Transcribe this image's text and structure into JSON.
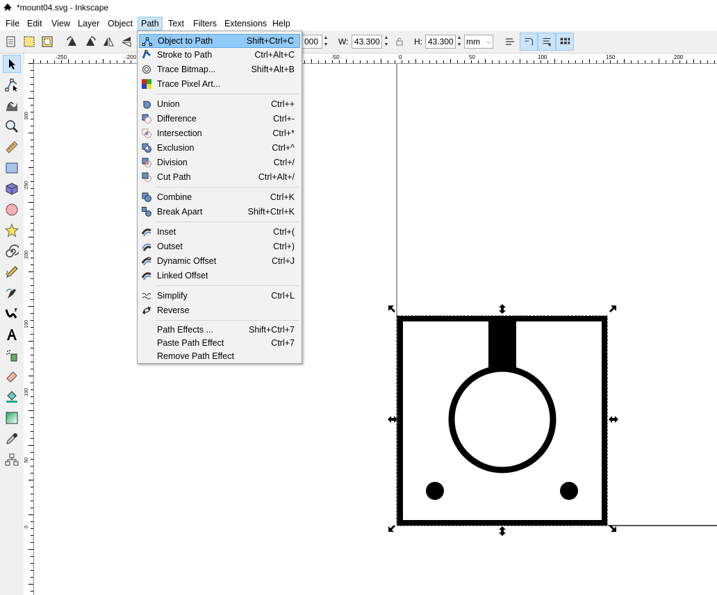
{
  "window": {
    "title": "*mount04.svg - Inkscape"
  },
  "menubar": {
    "items": [
      {
        "label": "File"
      },
      {
        "label": "Edit"
      },
      {
        "label": "View"
      },
      {
        "label": "Layer"
      },
      {
        "label": "Object"
      },
      {
        "label": "Path"
      },
      {
        "label": "Text"
      },
      {
        "label": "Filters"
      },
      {
        "label": "Extensions"
      },
      {
        "label": "Help"
      }
    ],
    "active": "Path"
  },
  "toolbar": {
    "x_value_partial": "000",
    "w_label": "W:",
    "w_value": "43.300",
    "h_label": "H:",
    "h_value": "43.300",
    "unit": "mm"
  },
  "path_menu": {
    "groups": [
      [
        {
          "label": "Object to Path",
          "shortcut": "Shift+Ctrl+C",
          "icon": "object-to-path-icon",
          "highlighted": true
        },
        {
          "label": "Stroke to Path",
          "shortcut": "Ctrl+Alt+C",
          "icon": "stroke-to-path-icon"
        },
        {
          "label": "Trace Bitmap...",
          "shortcut": "Shift+Alt+B",
          "icon": "trace-bitmap-icon"
        },
        {
          "label": "Trace Pixel Art...",
          "shortcut": "",
          "icon": "trace-pixel-art-icon"
        }
      ],
      [
        {
          "label": "Union",
          "shortcut": "Ctrl++",
          "icon": "union-icon"
        },
        {
          "label": "Difference",
          "shortcut": "Ctrl+-",
          "icon": "difference-icon"
        },
        {
          "label": "Intersection",
          "shortcut": "Ctrl+*",
          "icon": "intersection-icon"
        },
        {
          "label": "Exclusion",
          "shortcut": "Ctrl+^",
          "icon": "exclusion-icon"
        },
        {
          "label": "Division",
          "shortcut": "Ctrl+/",
          "icon": "division-icon"
        },
        {
          "label": "Cut Path",
          "shortcut": "Ctrl+Alt+/",
          "icon": "cut-path-icon"
        }
      ],
      [
        {
          "label": "Combine",
          "shortcut": "Ctrl+K",
          "icon": "combine-icon"
        },
        {
          "label": "Break Apart",
          "shortcut": "Shift+Ctrl+K",
          "icon": "break-apart-icon"
        }
      ],
      [
        {
          "label": "Inset",
          "shortcut": "Ctrl+(",
          "icon": "inset-icon"
        },
        {
          "label": "Outset",
          "shortcut": "Ctrl+)",
          "icon": "outset-icon"
        },
        {
          "label": "Dynamic Offset",
          "shortcut": "Ctrl+J",
          "icon": "dynamic-offset-icon"
        },
        {
          "label": "Linked Offset",
          "shortcut": "",
          "icon": "linked-offset-icon"
        }
      ],
      [
        {
          "label": "Simplify",
          "shortcut": "Ctrl+L",
          "icon": "simplify-icon"
        },
        {
          "label": "Reverse",
          "shortcut": "",
          "icon": "reverse-icon"
        }
      ],
      [
        {
          "label": "Path Effects ...",
          "shortcut": "Shift+Ctrl+7",
          "icon": ""
        },
        {
          "label": "Paste Path Effect",
          "shortcut": "Ctrl+7",
          "icon": ""
        },
        {
          "label": "Remove Path Effect",
          "shortcut": "",
          "icon": ""
        }
      ]
    ]
  },
  "rulers": {
    "h_ticks": [
      "-250",
      "-200",
      "-50",
      "0",
      "50",
      "100",
      "150",
      "200"
    ],
    "v_ticks": [
      "300",
      "250",
      "200",
      "150",
      "100",
      "50",
      "0"
    ]
  },
  "tools": [
    "selector-tool-icon",
    "node-tool-icon",
    "tweak-tool-icon",
    "zoom-tool-icon",
    "measure-tool-icon",
    "rectangle-tool-icon",
    "box-3d-tool-icon",
    "ellipse-tool-icon",
    "star-tool-icon",
    "spiral-tool-icon",
    "pencil-tool-icon",
    "pen-tool-icon",
    "calligraphy-tool-icon",
    "text-tool-icon",
    "spray-tool-icon",
    "eraser-tool-icon",
    "paint-bucket-tool-icon",
    "gradient-tool-icon",
    "dropper-tool-icon",
    "connector-tool-icon"
  ],
  "colors": {
    "highlight": "#91c9f7",
    "accent": "#cce4f7"
  }
}
